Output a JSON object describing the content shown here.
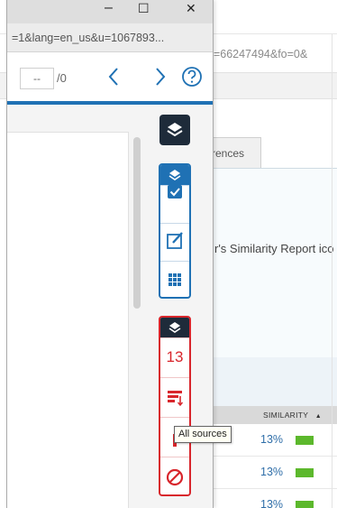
{
  "background_window": {
    "url_fragment": "d=66247494&fo=0&",
    "tab_label": "rences",
    "report_text": "r's Similarity Report ico",
    "similarity_header": "SIMILARITY",
    "rows": [
      {
        "similarity": "13%"
      },
      {
        "similarity": "13%"
      },
      {
        "similarity": "13%"
      }
    ],
    "bar_color": "#5cb82c"
  },
  "popup_window": {
    "controls": {
      "minimize": "–",
      "maximize": "☐",
      "close": "✕"
    },
    "address": "=1&lang=en_us&u=1067893...",
    "navigation": {
      "page_input": "--",
      "page_total": "/0",
      "prev_icon": "chevron-left-icon",
      "next_icon": "chevron-right-icon",
      "help_icon": "help-icon"
    },
    "accent_color": "#1f71b4",
    "sidebar": {
      "layers_icon": "layers-icon",
      "blue_group": [
        "layers-icon",
        "checkbox-icon",
        "edit-icon",
        "grid-icon"
      ],
      "red_group": {
        "cap_icon": "layers-icon",
        "match_count": "13",
        "filter_icon": "filter-sort-icon",
        "exclude_icon": "no-entry-icon"
      },
      "danger_color": "#d8262c"
    },
    "tooltip": "All sources"
  }
}
